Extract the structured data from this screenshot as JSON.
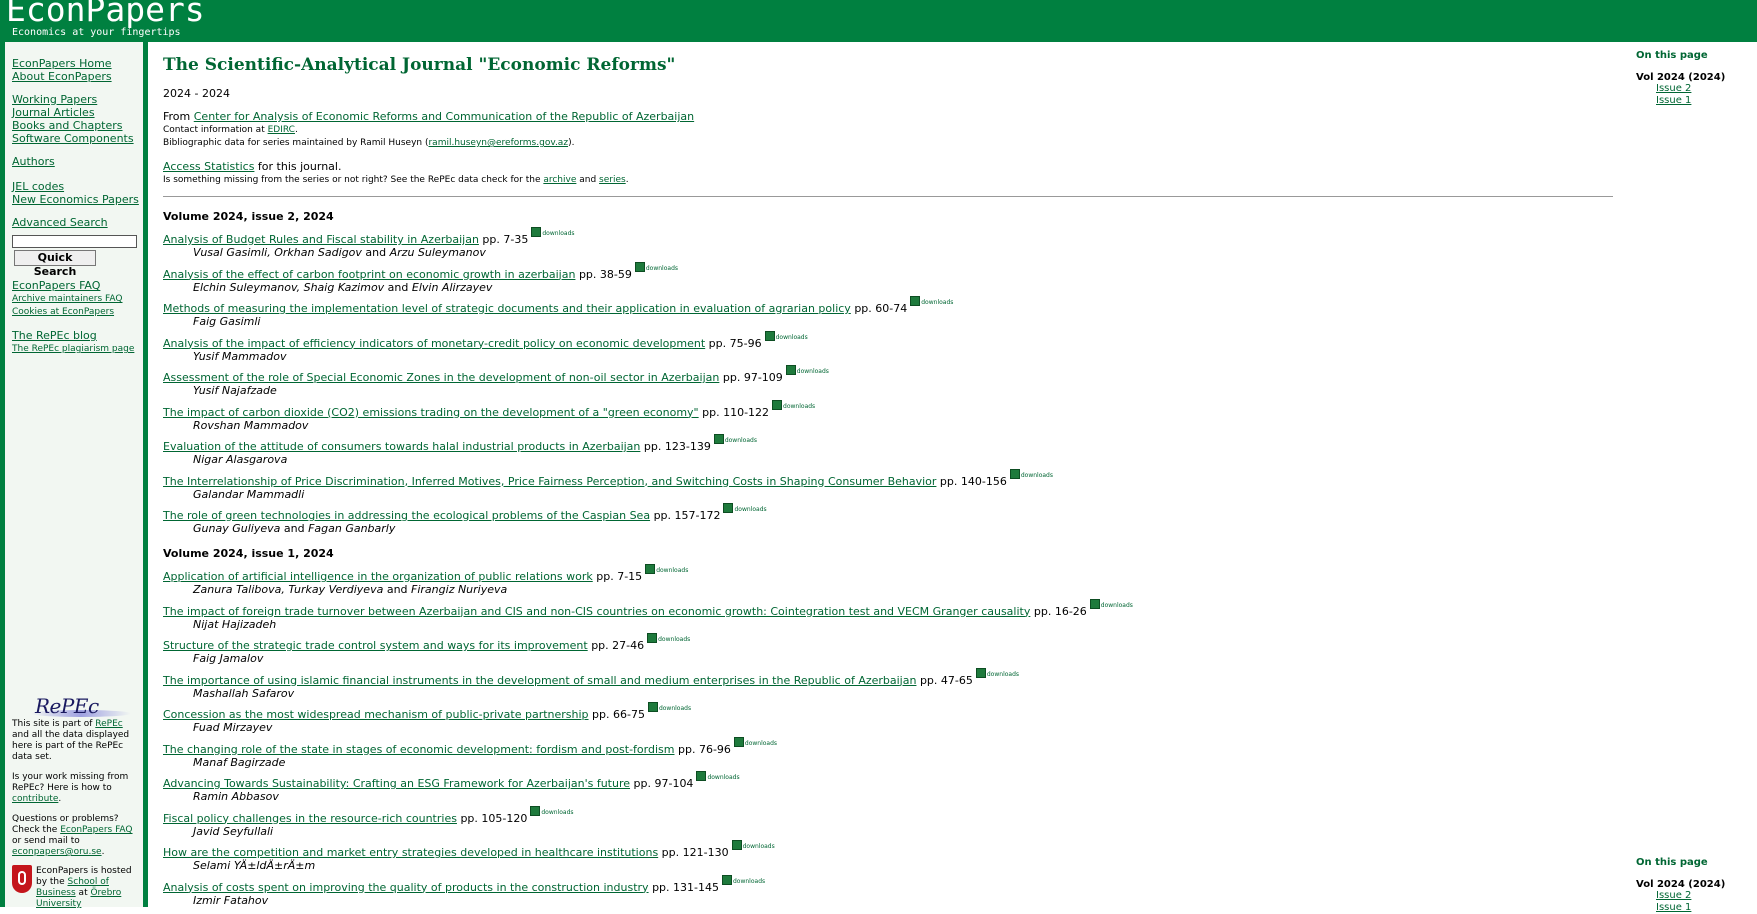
{
  "header": {
    "site_title": "EconPapers",
    "tagline": "Economics at your fingertips"
  },
  "sidebar": {
    "group1": [
      "EconPapers Home",
      "About EconPapers"
    ],
    "group2": [
      "Working Papers",
      "Journal Articles",
      "Books and Chapters",
      "Software Components"
    ],
    "group3": [
      "Authors"
    ],
    "group4": [
      "JEL codes",
      "New Economics Papers"
    ],
    "advanced_search": "Advanced Search",
    "search_placeholder": "",
    "search_button": "Quick Search",
    "group5": [
      "EconPapers FAQ"
    ],
    "group5_small": [
      "Archive maintainers FAQ",
      "Cookies at EconPapers"
    ],
    "blog": "The RePEc blog",
    "plagiarism": "The RePEc plagiarism page",
    "repec_logo": "RePEc",
    "repec_part_1": "This site is part of ",
    "repec_link": "RePEc",
    "repec_part_2": " and all the data displayed here is part of the RePEc data set.",
    "missing_1": "Is your work missing from RePEc? Here is how to ",
    "missing_link": "contribute",
    "missing_2": ".",
    "questions_1": "Questions or problems? Check the ",
    "questions_link": "EconPapers FAQ",
    "questions_2": " or send mail to ",
    "questions_mail": "econpapers@oru.se",
    "questions_3": ".",
    "hosted_1": "EconPapers is hosted by the ",
    "hosted_link1": "School of Business",
    "hosted_2": " at ",
    "hosted_link2": "Örebro University"
  },
  "main": {
    "title": "The Scientific-Analytical Journal \"Economic Reforms\"",
    "years": "2024 - 2024",
    "from_label": "From ",
    "from_link": "Center for Analysis of Economic Reforms and Communication of the Republic of Azerbaijan",
    "contact_label": "Contact information at ",
    "contact_link": "EDIRC",
    "contact_end": ".",
    "biblio_label": "Bibliographic data for series maintained by Ramil Huseyn (",
    "biblio_email": "ramil.huseyn@ereforms.gov.az",
    "biblio_end": ").",
    "access_link": "Access Statistics",
    "access_rest": " for this journal.",
    "missing_text": "Is something missing from the series or not right? See the RePEc data check for the ",
    "archive_link": "archive",
    "and_text": " and ",
    "series_link": "series",
    "missing_end": ".",
    "download_label": "downloads",
    "and_word": " and "
  },
  "issue2": {
    "heading": "Volume 2024, issue 2, 2024",
    "articles": [
      {
        "title": "Analysis of Budget Rules and Fiscal stability in Azerbaijan",
        "pages": "pp. 7-35",
        "authors_main": "Vusal Gasimli, Orkhan Sadigov",
        "authors_last": "Arzu Suleymanov"
      },
      {
        "title": "Analysis of the effect of carbon footprint on economic growth in azerbaijan",
        "pages": "pp. 38-59",
        "authors_main": "Elchin Suleymanov, Shaig Kazimov",
        "authors_last": "Elvin Alirzayev"
      },
      {
        "title": "Methods of measuring the implementation level of strategic documents and their application in evaluation of agrarian policy",
        "pages": "pp. 60-74",
        "authors_main": "Faig Gasimli",
        "authors_last": ""
      },
      {
        "title": "Analysis of the impact of efficiency indicators of monetary-credit policy on economic development",
        "pages": "pp. 75-96",
        "authors_main": "Yusif Mammadov",
        "authors_last": ""
      },
      {
        "title": "Assessment of the role of Special Economic Zones in the development of non-oil sector in Azerbaijan",
        "pages": "pp. 97-109",
        "authors_main": "Yusif Najafzade",
        "authors_last": ""
      },
      {
        "title": "The impact of carbon dioxide (CO2) emissions trading on the development of a \"green economy\"",
        "pages": "pp. 110-122",
        "authors_main": "Rovshan Mammadov",
        "authors_last": ""
      },
      {
        "title": "Evaluation of the attitude of consumers towards halal industrial products in Azerbaijan",
        "pages": "pp. 123-139",
        "authors_main": "Nigar Alasgarova",
        "authors_last": ""
      },
      {
        "title": "The Interrelationship of Price Discrimination, Inferred Motives, Price Fairness Perception, and Switching Costs in Shaping Consumer Behavior",
        "pages": "pp. 140-156",
        "authors_main": "Galandar Mammadli",
        "authors_last": ""
      },
      {
        "title": "The role of green technologies in addressing the ecological problems of the Caspian Sea",
        "pages": "pp. 157-172",
        "authors_main": "Gunay Guliyeva",
        "authors_last": "Fagan Ganbarly"
      }
    ]
  },
  "issue1": {
    "heading": "Volume 2024, issue 1, 2024",
    "articles": [
      {
        "title": "Application of artificial intelligence in the organization of public relations work",
        "pages": "pp. 7-15",
        "authors_main": "Zanura Talibova, Turkay Verdiyeva",
        "authors_last": "Firangiz Nuriyeva"
      },
      {
        "title": "The impact of foreign trade turnover between Azerbaijan and CIS and non-CIS countries on economic growth: Cointegration test and VECM Granger causality",
        "pages": "pp. 16-26",
        "authors_main": "Nijat Hajizadeh",
        "authors_last": ""
      },
      {
        "title": "Structure of the strategic trade control system and ways for its improvement",
        "pages": "pp. 27-46",
        "authors_main": "Faig Jamalov",
        "authors_last": ""
      },
      {
        "title": "The importance of using islamic financial instruments in the development of small and medium enterprises in the Republic of Azerbaijan",
        "pages": "pp. 47-65",
        "authors_main": "Mashallah Safarov",
        "authors_last": ""
      },
      {
        "title": "Concession as the most widespread mechanism of public-private partnership",
        "pages": "pp. 66-75",
        "authors_main": "Fuad Mirzayev",
        "authors_last": ""
      },
      {
        "title": "The changing role of the state in stages of economic development: fordism and post-fordism",
        "pages": "pp. 76-96",
        "authors_main": "Manaf Bagirzade",
        "authors_last": ""
      },
      {
        "title": "Advancing Towards Sustainability: Crafting an ESG Framework for Azerbaijan's future",
        "pages": "pp. 97-104",
        "authors_main": "Ramin Abbasov",
        "authors_last": ""
      },
      {
        "title": "Fiscal policy challenges in the resource-rich countries",
        "pages": "pp. 105-120",
        "authors_main": "Javid Seyfullali",
        "authors_last": ""
      },
      {
        "title": "How are the competition and market entry strategies developed in healthcare institutions",
        "pages": "pp. 121-130",
        "authors_main": "Selami YÄ±ldÄ±rÄ±m",
        "authors_last": ""
      },
      {
        "title": "Analysis of costs spent on improving the quality of products in the construction industry",
        "pages": "pp. 131-145",
        "authors_main": "Izmir Fatahov",
        "authors_last": ""
      }
    ]
  },
  "right_nav": {
    "heading": "On this page",
    "volume": "Vol 2024 (2024)",
    "issues": [
      "Issue 2",
      "Issue 1"
    ]
  }
}
